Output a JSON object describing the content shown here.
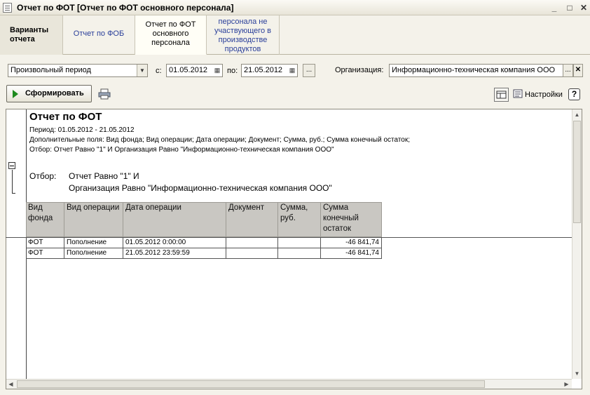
{
  "window": {
    "title": "Отчет по ФОТ [Отчет по ФОТ основного персонала]",
    "minimize_label": "_",
    "maximize_label": "□",
    "close_label": "✕"
  },
  "tabs": [
    {
      "label": "Варианты отчета",
      "active": false
    },
    {
      "label": "Отчет по ФОБ",
      "active": false
    },
    {
      "label": "Отчет по ФОТ основного персонала",
      "active": true
    },
    {
      "label": "персонала не участвующего в производстве продуктов",
      "active": false
    }
  ],
  "filters": {
    "period_type": "Произвольный период",
    "from_label": "с:",
    "from_date": "01.05.2012",
    "to_label": "по:",
    "to_date": "21.05.2012",
    "ellipsis_label": "...",
    "org_label": "Организация:",
    "org_value": "Информационно-техническая компания ООО",
    "org_clear_label": "✕"
  },
  "toolbar": {
    "generate_label": "Сформировать",
    "settings_label": "Настройки",
    "help_label": "?"
  },
  "report": {
    "title": "Отчет по ФОТ",
    "period": "Период: 01.05.2012 - 21.05.2012",
    "extra_fields": "Дополнительные поля: Вид фонда; Вид операции; Дата операции; Документ; Сумма, руб.; Сумма конечный остаток;",
    "filter_line": "Отбор: Отчет Равно \"1\" И Организация Равно \"Информационно-техническая компания ООО\"",
    "filter_label": "Отбор:",
    "filter_cond_1": "Отчет Равно \"1\" И",
    "filter_cond_2": "Организация Равно \"Информационно-техническая компания ООО\"",
    "columns": [
      "Вид фонда",
      "Вид операции",
      "Дата операции",
      "Документ",
      "Сумма, руб.",
      "Сумма конечный остаток"
    ],
    "rows": [
      {
        "fund": "ФОТ",
        "operation": "Пополнение",
        "date": "01.05.2012 0:00:00",
        "document": "",
        "sum": "",
        "balance": "-46 841,74"
      },
      {
        "fund": "ФОТ",
        "operation": "Пополнение",
        "date": "21.05.2012 23:59:59",
        "document": "",
        "sum": "",
        "balance": "-46 841,74"
      }
    ]
  },
  "colors": {
    "accent_link": "#2a3f9a",
    "header_bg": "#c9c7c2",
    "play_green": "#1e8a1e"
  }
}
